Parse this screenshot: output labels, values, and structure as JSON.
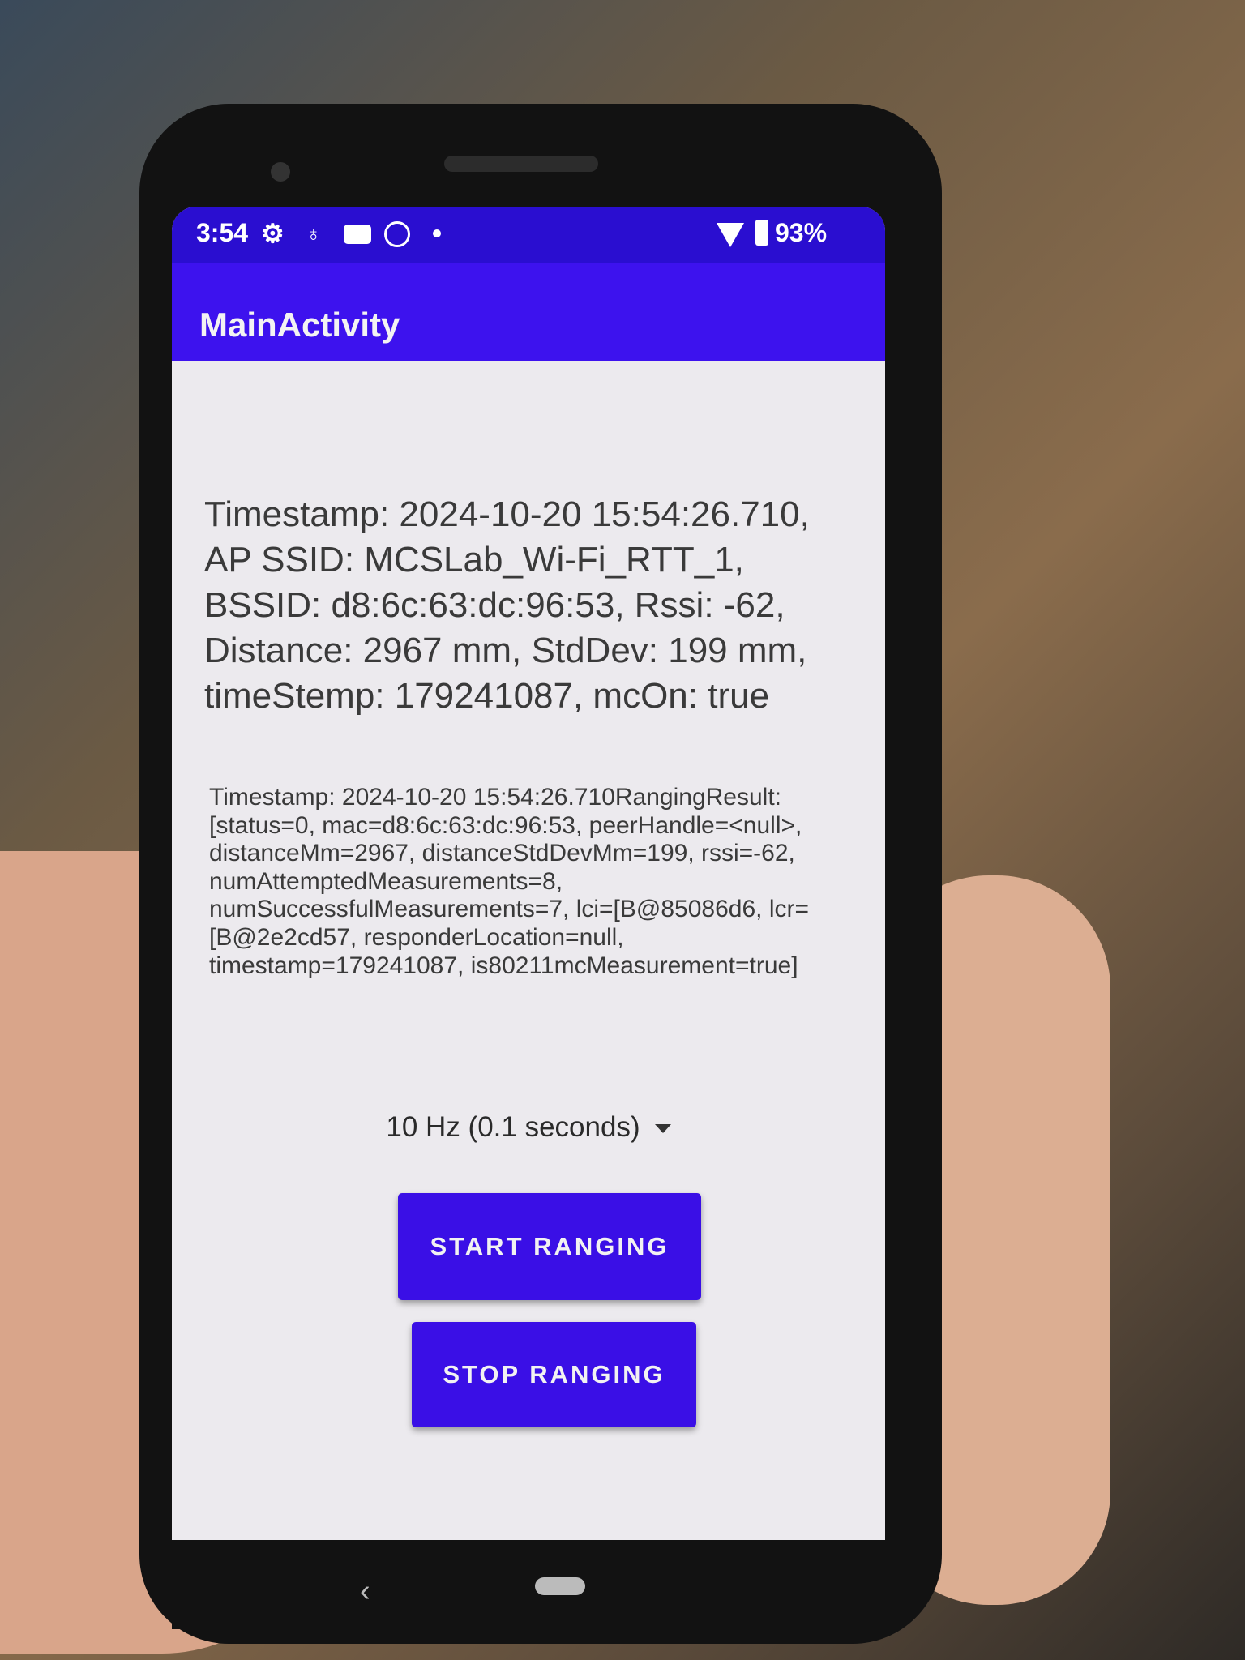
{
  "status_bar": {
    "time": "3:54",
    "icons": [
      "gear-icon",
      "pin-icon",
      "youtube-icon",
      "sync-icon",
      "dot-icon"
    ],
    "wifi_icon": "wifi-icon",
    "battery_icon": "battery-icon",
    "battery": "93%"
  },
  "app_bar": {
    "title": "MainActivity"
  },
  "main": {
    "summary": "Timestamp: 2024-10-20 15:54:26.710, AP SSID: MCSLab_Wi-Fi_RTT_1, BSSID: d8:6c:63:dc:96:53, Rssi: -62, Distance: 2967 mm, StdDev: 199 mm, timeStemp: 179241087, mcOn: true",
    "raw_result": "Timestamp: 2024-10-20 15:54:26.710RangingResult: [status=0, mac=d8:6c:63:dc:96:53, peerHandle=<null>, distanceMm=2967, distanceStdDevMm=199, rssi=-62, numAttemptedMeasurements=8, numSuccessfulMeasurements=7, lci=[B@85086d6, lcr=[B@2e2cd57, responderLocation=null, timestamp=179241087, is80211mcMeasurement=true]",
    "frequency_select": {
      "selected": "10 Hz (0.1 seconds)"
    },
    "start_button": "START RANGING",
    "stop_button": "STOP RANGING"
  },
  "colors": {
    "primary": "#3d12ee",
    "status_bar": "#2a0ed0",
    "button": "#3a0fe6",
    "background": "#eceaee"
  }
}
